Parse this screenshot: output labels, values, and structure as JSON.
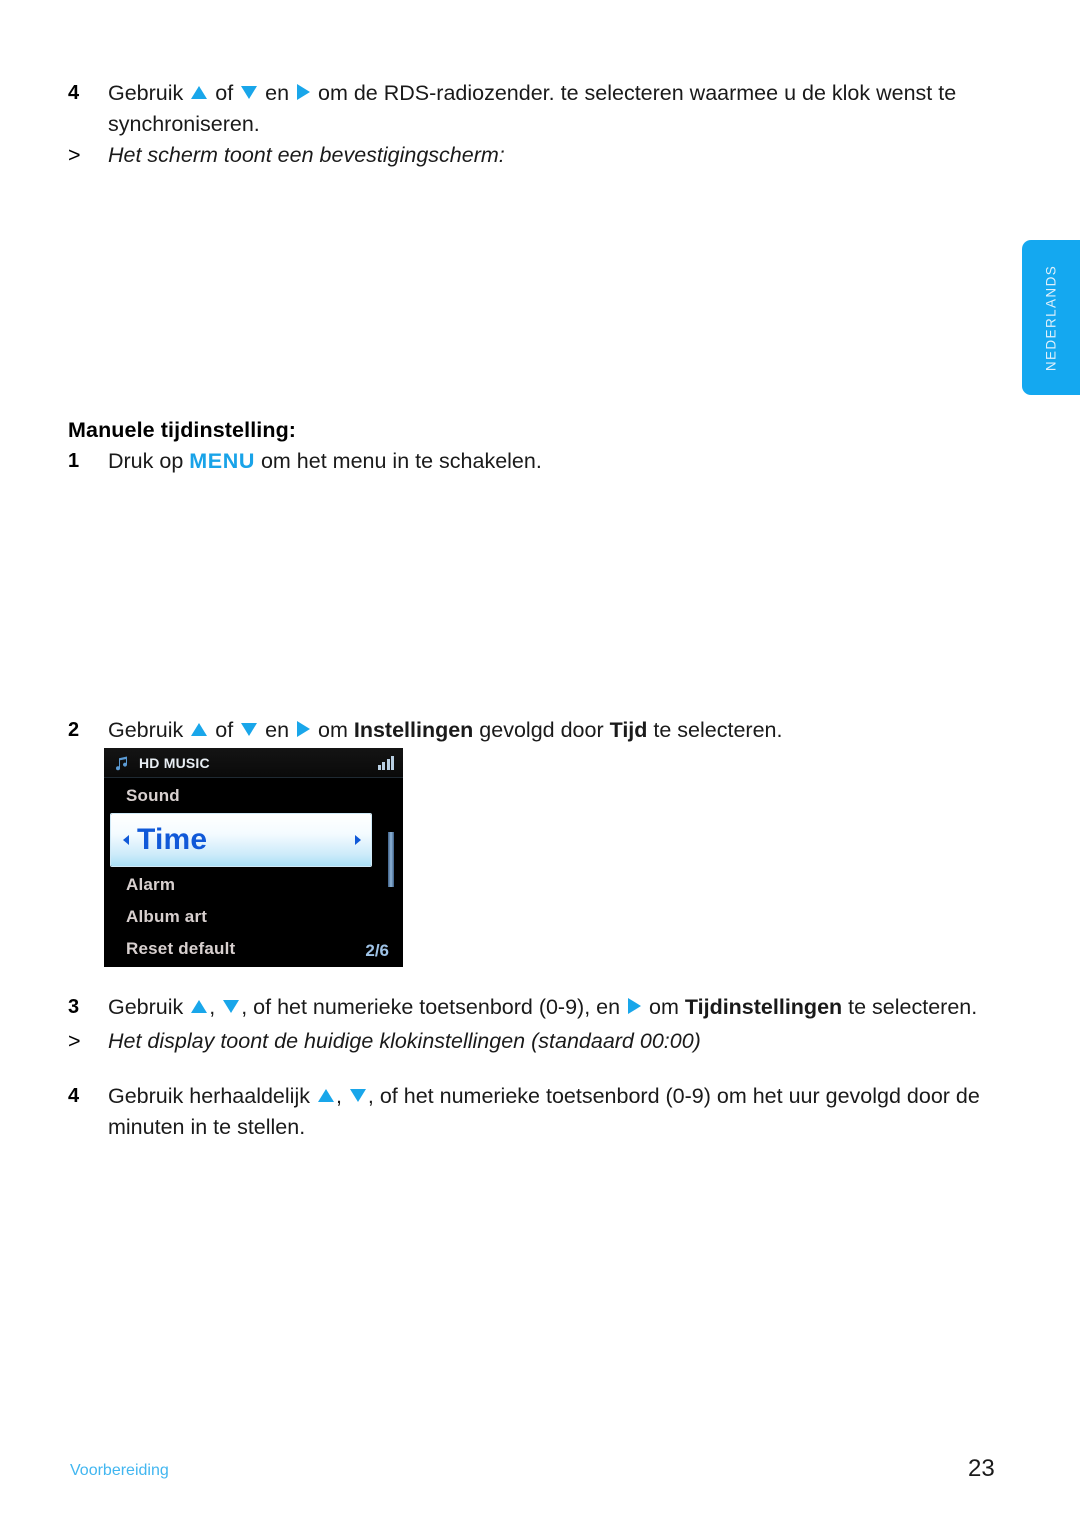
{
  "language_tab": {
    "label": "NEDERLANDS",
    "color": "#14a8f0"
  },
  "accent_color": "#19a6ea",
  "steps": {
    "step4_top": {
      "number": "4",
      "text_a": "Gebruik ",
      "text_b": " of ",
      "text_c": " en ",
      "text_d": " om de RDS-radiozender. te selecteren waarmee u de klok wenst te synchroniseren."
    },
    "note_top": {
      "marker": ">",
      "text": "Het scherm toont een bevestigingscherm:"
    },
    "subhead": "Manuele tijdinstelling:",
    "step1": {
      "number": "1",
      "text_a": "Druk op ",
      "menu_label": "MENU",
      "text_b": " om het menu in te schakelen."
    },
    "step2": {
      "number": "2",
      "text_a": "Gebruik ",
      "text_b": " of ",
      "text_c": " en ",
      "text_d": " om ",
      "bold_1": "Instellingen",
      "text_e": " gevolgd door ",
      "bold_2": "Tijd",
      "text_f": " te selecteren."
    },
    "step3": {
      "number": "3",
      "text_a": "Gebruik ",
      "text_b": ", ",
      "text_c": ", of het numerieke toetsenbord (0-9), en ",
      "text_d": " om ",
      "bold_1": "Tijdinstellingen",
      "text_e": " te selecteren."
    },
    "note_mid": {
      "marker": ">",
      "text": "Het display toont de huidige klokinstellingen (standaard 00:00)"
    },
    "step4_bottom": {
      "number": "4",
      "text_a": "Gebruik herhaaldelijk ",
      "text_b": ", ",
      "text_c": ", of het numerieke toetsenbord (0-9) om het uur gevolgd door de minuten in te stellen."
    }
  },
  "device_screen": {
    "title": "HD MUSIC",
    "music_icon": "music-note-icon",
    "signal_icon": "signal-strength-icon",
    "rows": [
      {
        "label": "Sound",
        "selected": false
      },
      {
        "label": "Time",
        "selected": true
      },
      {
        "label": "Alarm",
        "selected": false
      },
      {
        "label": "Album art",
        "selected": false
      },
      {
        "label": "Reset default",
        "selected": false
      }
    ],
    "page_count": "2/6"
  },
  "footer": {
    "section": "Voorbereiding",
    "page_number": "23"
  }
}
